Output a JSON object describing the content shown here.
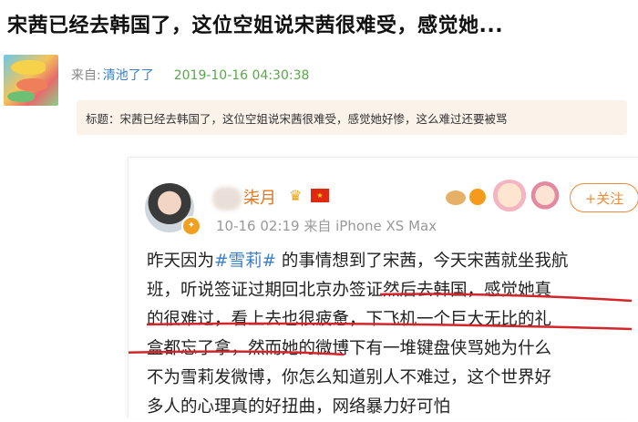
{
  "headline": "宋茜已经去韩国了，这位空姐说宋茜很难受，感觉她...",
  "post_meta": {
    "from_label": "来自:",
    "author": "清池了了",
    "timestamp": "2019-10-16 04:30:38"
  },
  "quote": {
    "text": "标题：宋茜已经去韩国了，这位空姐说宋茜很难受，感觉她好惨，这么难过还要被骂"
  },
  "weibo_card": {
    "user_name": "柒月",
    "crown_icon": "crown-icon",
    "flag_icon": "china-flag-icon",
    "post_time": "10-16 02:19  来自 iPhone XS Max",
    "follow_label": "+关注",
    "accent_color": "#f18b3a",
    "body_lines": [
      {
        "before": "昨天因为",
        "hashtag": "#雪莉#",
        "after": " 的事情想到了宋茜，今天宋茜就坐我航"
      },
      {
        "text": "班，听说签证过期回北京办签证然后去韩国，感觉她真"
      },
      {
        "text": "的很难过，看上去也很疲惫，下飞机一个巨大无比的礼"
      },
      {
        "text": "盒都忘了拿，然而她的微博下有一堆键盘侠骂她为什么"
      },
      {
        "text": "不为雪莉发微博，你怎么知道别人不难过，这个世界好"
      },
      {
        "text": "多人的心理真的好扭曲，网络暴力好可怕"
      }
    ],
    "underline_color": "#d3262b"
  }
}
